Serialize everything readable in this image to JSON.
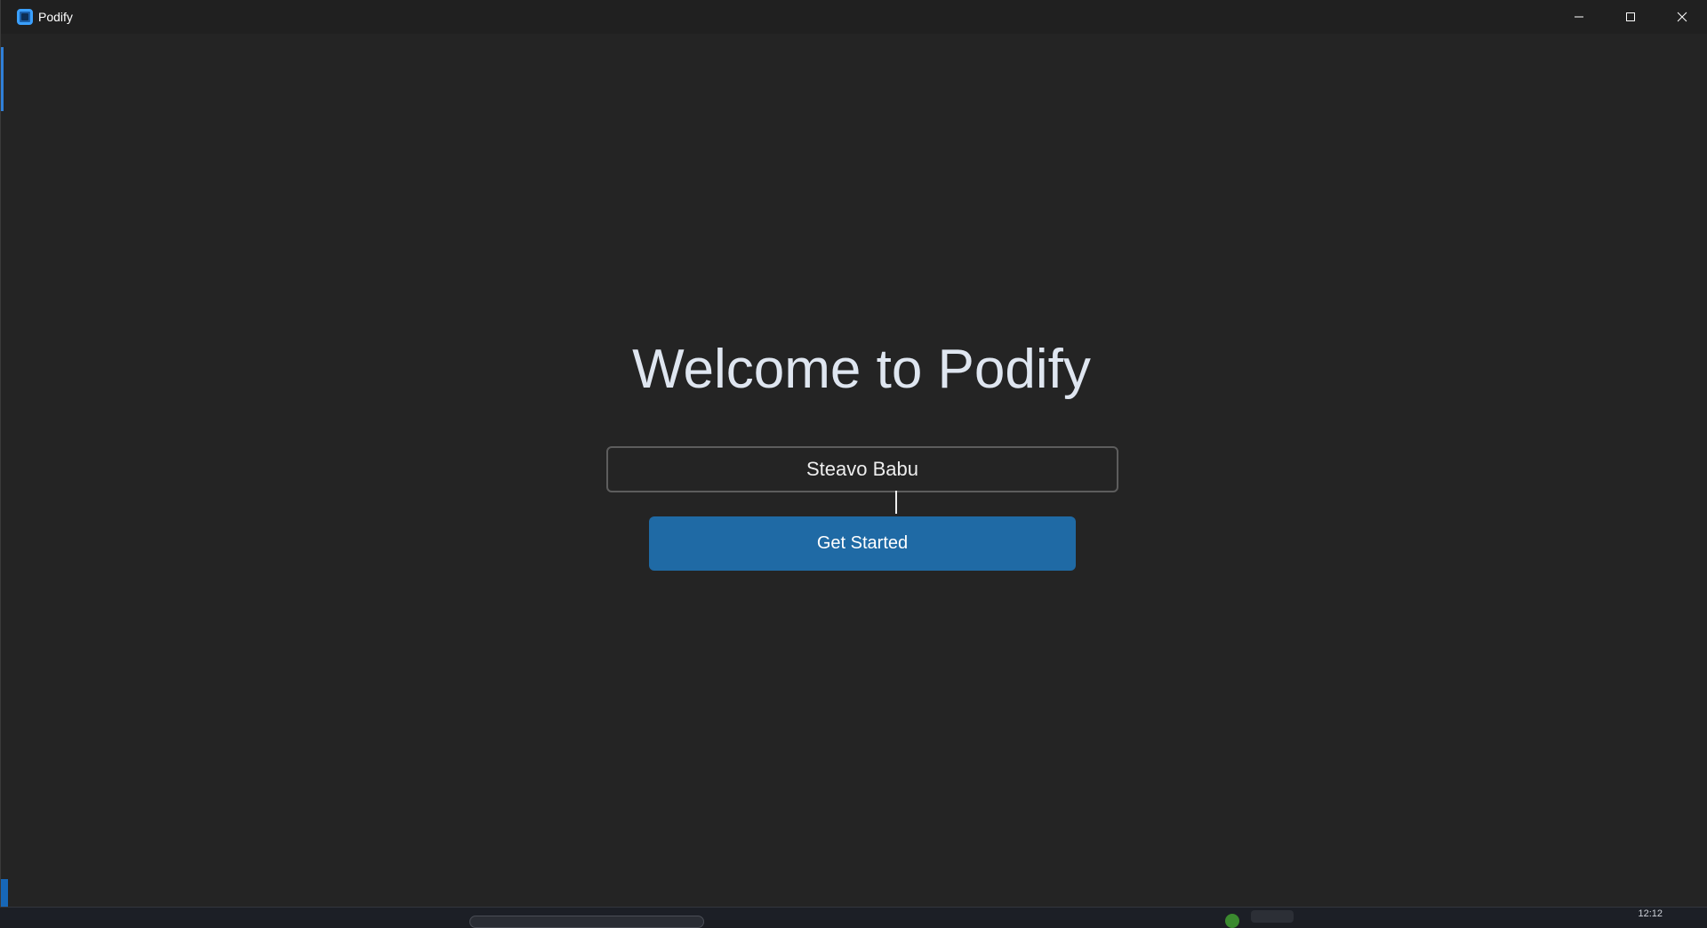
{
  "window": {
    "title": "Podify",
    "controls": {
      "minimize_icon": "minimize-icon",
      "maximize_icon": "maximize-icon",
      "close_icon": "close-icon"
    }
  },
  "main": {
    "heading": "Welcome to Podify",
    "name_input": {
      "value": "Steavo Babu"
    },
    "get_started_label": "Get Started"
  },
  "taskbar": {
    "clock": "12:12"
  },
  "colors": {
    "background": "#242424",
    "titlebar": "#202020",
    "accent": "#1f6aa5",
    "heading_text": "#dfe6f0",
    "input_border": "#5d5d5d"
  }
}
